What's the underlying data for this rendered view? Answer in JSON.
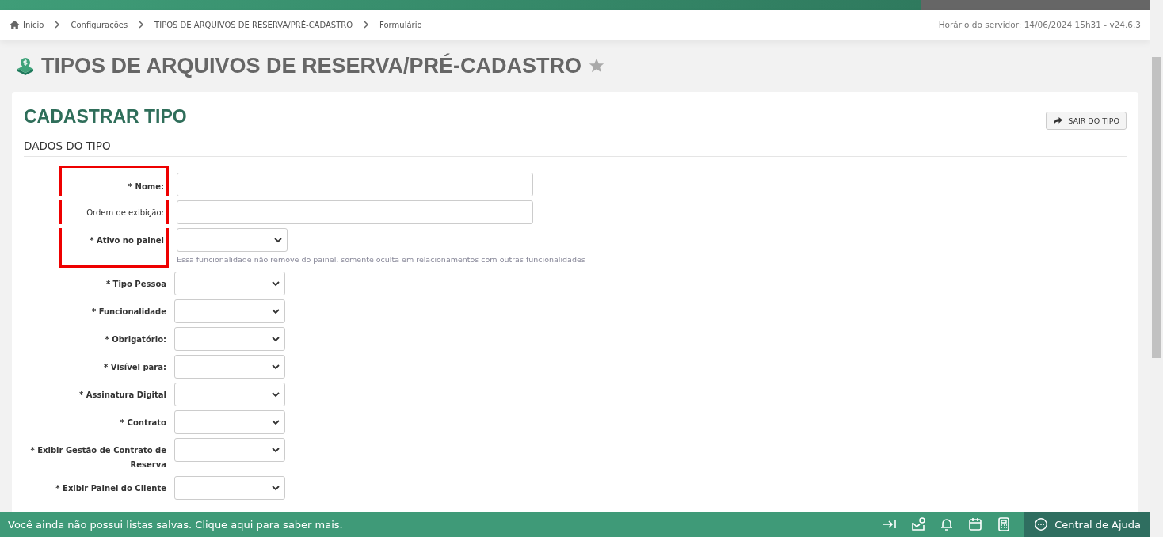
{
  "breadcrumb": [
    {
      "label": "Início",
      "kind": "home"
    },
    {
      "label": "Configurações",
      "kind": "link"
    },
    {
      "label": "TIPOS DE ARQUIVOS DE RESERVA/PRÉ-CADASTRO",
      "kind": "link"
    },
    {
      "label": "Formulário",
      "kind": "link"
    }
  ],
  "server_time": "Horário do servidor: 14/06/2024 15h31 - v24.6.3",
  "page_title": "TIPOS DE ARQUIVOS DE RESERVA/PRÉ-CADASTRO",
  "card": {
    "title": "CADASTRAR TIPO",
    "exit_button": "SAIR DO TIPO",
    "section": "DADOS DO TIPO",
    "fields": [
      {
        "marker": "*",
        "label": "Nome:",
        "kind": "text",
        "highlighted": true
      },
      {
        "label": "Ordem de exibição:",
        "kind": "text",
        "highlighted": true
      },
      {
        "marker": "*",
        "label": "Ativo no painel",
        "kind": "select",
        "highlighted": true,
        "hint": "Essa funcionalidade não remove do painel, somente oculta em relacionamentos com outras funcionalidades"
      },
      {
        "marker": "*",
        "label": "Tipo Pessoa",
        "kind": "select",
        "highlighted": false
      },
      {
        "marker": "*",
        "label": "Funcionalidade",
        "kind": "select",
        "highlighted": false
      },
      {
        "marker": "*",
        "label": "Obrigatório:",
        "kind": "select",
        "highlighted": false
      },
      {
        "marker": "*",
        "label": "Visível para:",
        "kind": "select",
        "highlighted": false
      },
      {
        "marker": "*",
        "label": "Assinatura Digital",
        "kind": "select",
        "highlighted": false
      },
      {
        "marker": "*",
        "label": "Contrato",
        "kind": "select",
        "highlighted": false
      },
      {
        "marker": "*",
        "label": "Exibir Gestão de Contrato de Reserva",
        "kind": "select",
        "highlighted": false
      },
      {
        "marker": "*",
        "label": "Exibir Painel do Cliente",
        "kind": "select",
        "highlighted": false
      }
    ]
  },
  "footer": {
    "message": "Você ainda não possui listas salvas. Clique aqui para saber mais.",
    "help": "Central de Ajuda"
  }
}
